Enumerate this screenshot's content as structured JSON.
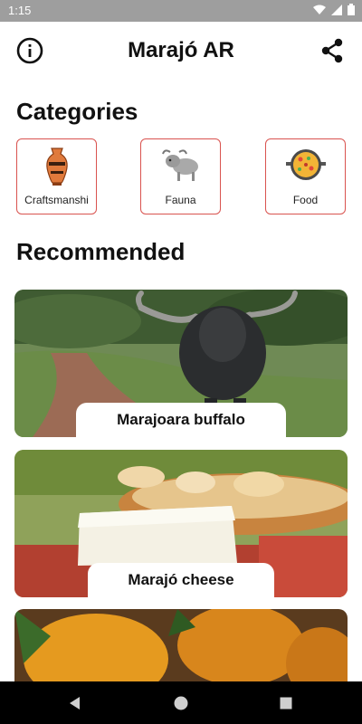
{
  "status_bar": {
    "time": "1:15"
  },
  "app_bar": {
    "title": "Marajó AR",
    "info_icon": "info-icon",
    "share_icon": "share-icon"
  },
  "categories": {
    "title": "Categories",
    "items": [
      {
        "label": "Craftsmanshi",
        "icon": "vase-icon"
      },
      {
        "label": "Fauna",
        "icon": "buffalo-icon"
      },
      {
        "label": "Food",
        "icon": "paella-icon"
      }
    ]
  },
  "recommended": {
    "title": "Recommended",
    "items": [
      {
        "label": "Marajoara buffalo",
        "image": "buffalo-photo"
      },
      {
        "label": "Marajó cheese",
        "image": "cheese-photo"
      },
      {
        "label": "",
        "image": "pineapple-photo"
      }
    ]
  },
  "nav_bar": {
    "back_icon": "back-icon",
    "home_icon": "home-icon",
    "recents_icon": "recents-icon"
  },
  "colors": {
    "card_border": "#d9534f",
    "status_bar": "#9e9e9e",
    "nav_bar": "#000000"
  }
}
